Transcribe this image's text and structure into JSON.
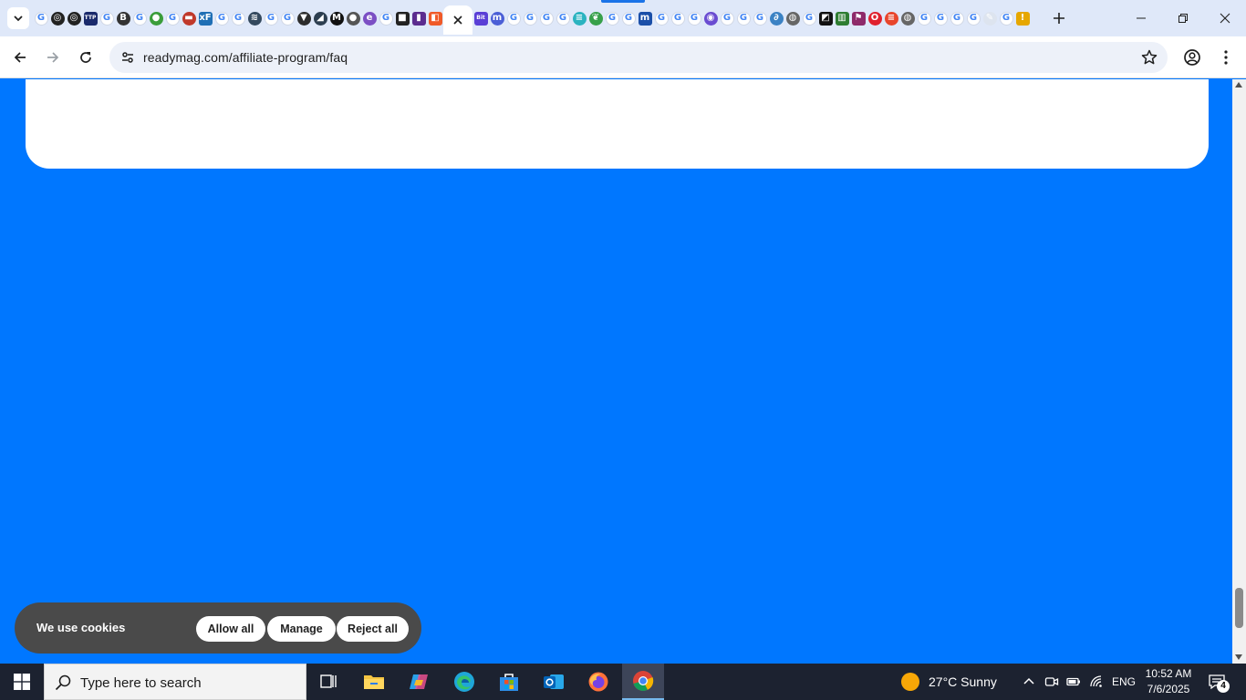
{
  "browser": {
    "active_tab_close_label": "×",
    "new_tab_label": "+",
    "url": "readymag.com/affiliate-program/faq",
    "favicons": [
      {
        "name": "google-icon",
        "glyph": "G",
        "style": "g"
      },
      {
        "name": "openai-icon",
        "glyph": "◎",
        "bg": "#222222"
      },
      {
        "name": "openai-icon",
        "glyph": "◎",
        "bg": "#222222"
      },
      {
        "name": "ttp-icon",
        "glyph": "TTP",
        "bg": "#1a2a6c",
        "shape": "sq"
      },
      {
        "name": "google-icon",
        "glyph": "G",
        "style": "g"
      },
      {
        "name": "b-icon",
        "glyph": "B",
        "bg": "#333333"
      },
      {
        "name": "google-icon",
        "glyph": "G",
        "style": "g"
      },
      {
        "name": "globe-green-icon",
        "glyph": "●",
        "bg": "#3a9d3a"
      },
      {
        "name": "google-icon",
        "glyph": "G",
        "style": "g"
      },
      {
        "name": "bus-icon",
        "glyph": "▬",
        "bg": "#c0392b"
      },
      {
        "name": "xf-icon",
        "glyph": "xF",
        "bg": "#1f6fb5",
        "shape": "sq"
      },
      {
        "name": "google-icon",
        "glyph": "G",
        "style": "g"
      },
      {
        "name": "google-icon",
        "glyph": "G",
        "style": "g"
      },
      {
        "name": "stack-icon",
        "glyph": "≋",
        "bg": "#34495e"
      },
      {
        "name": "google-icon",
        "glyph": "G",
        "style": "g"
      },
      {
        "name": "google-icon",
        "glyph": "G",
        "style": "g"
      },
      {
        "name": "triangle-icon",
        "glyph": "▼",
        "bg": "#2c2c2c"
      },
      {
        "name": "leaf-icon",
        "glyph": "◢",
        "bg": "#2c3e50"
      },
      {
        "name": "m-icon",
        "glyph": "M",
        "bg": "#111111"
      },
      {
        "name": "avatar-icon",
        "glyph": "●",
        "bg": "#555555"
      },
      {
        "name": "edge-copilot-icon",
        "glyph": "e",
        "bg": "#7b4fc4"
      },
      {
        "name": "google-icon",
        "glyph": "G",
        "style": "g"
      },
      {
        "name": "cube-icon",
        "glyph": "■",
        "bg": "#222222",
        "shape": "sq"
      },
      {
        "name": "mobile-icon",
        "glyph": "▮",
        "bg": "#5b2c8f",
        "shape": "sq"
      },
      {
        "name": "orange-app-icon",
        "glyph": "◧",
        "bg": "#f05a28",
        "shape": "sq"
      }
    ],
    "favicons_right": [
      {
        "name": "bit-icon",
        "glyph": "Bit",
        "bg": "#5a3fd6",
        "shape": "sq"
      },
      {
        "name": "m-purple-icon",
        "glyph": "m",
        "bg": "#4b5fd6"
      },
      {
        "name": "google-icon",
        "glyph": "G",
        "style": "g"
      },
      {
        "name": "google-icon",
        "glyph": "G",
        "style": "g"
      },
      {
        "name": "google-icon",
        "glyph": "G",
        "style": "g"
      },
      {
        "name": "google-icon",
        "glyph": "G",
        "style": "g"
      },
      {
        "name": "stripe-icon",
        "glyph": "≡",
        "bg": "#2bb3c0"
      },
      {
        "name": "leaf-green-icon",
        "glyph": "❦",
        "bg": "#37a04a"
      },
      {
        "name": "google-icon",
        "glyph": "G",
        "style": "g"
      },
      {
        "name": "google-icon",
        "glyph": "G",
        "style": "g"
      },
      {
        "name": "m-blue-icon",
        "glyph": "m",
        "bg": "#1b4fa8",
        "shape": "sq"
      },
      {
        "name": "google-icon",
        "glyph": "G",
        "style": "g"
      },
      {
        "name": "google-icon",
        "glyph": "G",
        "style": "g"
      },
      {
        "name": "google-icon",
        "glyph": "G",
        "style": "g"
      },
      {
        "name": "circle-purple-icon",
        "glyph": "◉",
        "bg": "#6a4cd1"
      },
      {
        "name": "google-icon",
        "glyph": "G",
        "style": "g"
      },
      {
        "name": "google-icon",
        "glyph": "G",
        "style": "g"
      },
      {
        "name": "google-icon",
        "glyph": "G",
        "style": "g"
      },
      {
        "name": "link-icon",
        "glyph": "∂",
        "bg": "#3b82c4"
      },
      {
        "name": "globe-icon",
        "glyph": "◍",
        "bg": "#666666"
      },
      {
        "name": "google-icon",
        "glyph": "G",
        "style": "g"
      },
      {
        "name": "green-square-icon",
        "glyph": "◩",
        "bg": "#111111",
        "shape": "sq"
      },
      {
        "name": "chart-icon",
        "glyph": "▥",
        "bg": "#2e7d32",
        "shape": "sq"
      },
      {
        "name": "flag-icon",
        "glyph": "⚑",
        "bg": "#8e2a6a",
        "shape": "sq"
      },
      {
        "name": "opera-icon",
        "glyph": "O",
        "bg": "#e0212e"
      },
      {
        "name": "stripes-icon",
        "glyph": "≡",
        "bg": "#e8452c"
      },
      {
        "name": "globe-icon",
        "glyph": "◍",
        "bg": "#666666"
      },
      {
        "name": "google-icon",
        "glyph": "G",
        "style": "g"
      },
      {
        "name": "google-icon",
        "glyph": "G",
        "style": "g"
      },
      {
        "name": "google-icon",
        "glyph": "G",
        "style": "g"
      },
      {
        "name": "google-icon",
        "glyph": "G",
        "style": "g"
      },
      {
        "name": "pen-icon",
        "glyph": "✎",
        "bg": "#dde4ef"
      },
      {
        "name": "google-icon",
        "glyph": "G",
        "style": "g"
      },
      {
        "name": "warning-icon",
        "glyph": "!",
        "bg": "#e6a700",
        "shape": "sq"
      }
    ]
  },
  "page": {
    "background_color": "#0077ff",
    "cookie_banner": {
      "message": "We use cookies",
      "allow_all": "Allow all",
      "manage": "Manage",
      "reject_all": "Reject all"
    }
  },
  "taskbar": {
    "search_placeholder": "Type here to search",
    "apps": [
      {
        "name": "task-view-icon"
      },
      {
        "name": "file-explorer-icon"
      },
      {
        "name": "copilot-icon"
      },
      {
        "name": "edge-icon"
      },
      {
        "name": "microsoft-store-icon"
      },
      {
        "name": "outlook-icon"
      },
      {
        "name": "firefox-icon"
      },
      {
        "name": "chrome-icon"
      }
    ],
    "weather": "27°C  Sunny",
    "language": "ENG",
    "time": "10:52 AM",
    "date": "7/6/2025",
    "notification_count": "4"
  }
}
